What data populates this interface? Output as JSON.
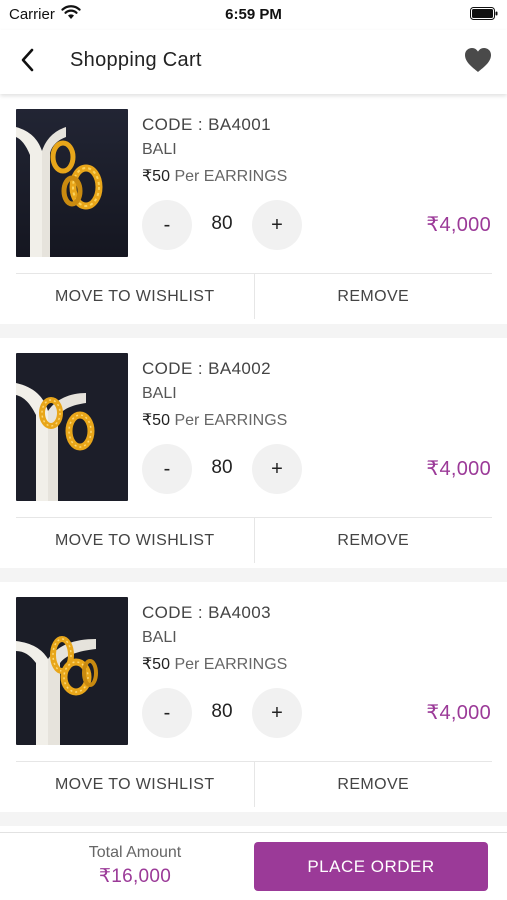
{
  "status_bar": {
    "carrier": "Carrier",
    "time": "6:59 PM"
  },
  "nav": {
    "title": "Shopping Cart",
    "back_icon": "chevron-left-icon",
    "wishlist_icon": "heart-icon"
  },
  "cart": {
    "items": [
      {
        "code": "CODE : BA4001",
        "category": "BALI",
        "price": "₹50",
        "per_unit": "Per EARRINGS",
        "quantity": "80",
        "line_total": "₹4,000",
        "minus_label": "-",
        "plus_label": "+",
        "move_label": "MOVE TO WISHLIST",
        "remove_label": "REMOVE"
      },
      {
        "code": "CODE : BA4002",
        "category": "BALI",
        "price": "₹50",
        "per_unit": "Per EARRINGS",
        "quantity": "80",
        "line_total": "₹4,000",
        "minus_label": "-",
        "plus_label": "+",
        "move_label": "MOVE TO WISHLIST",
        "remove_label": "REMOVE"
      },
      {
        "code": "CODE : BA4003",
        "category": "BALI",
        "price": "₹50",
        "per_unit": "Per EARRINGS",
        "quantity": "80",
        "line_total": "₹4,000",
        "minus_label": "-",
        "plus_label": "+",
        "move_label": "MOVE TO WISHLIST",
        "remove_label": "REMOVE"
      }
    ]
  },
  "footer": {
    "total_label": "Total Amount",
    "total_value": "₹16,000",
    "place_order_label": "PLACE ORDER"
  },
  "colors": {
    "accent": "#9b3a98",
    "product_background": "#1a1c28",
    "gold": "#e8a61a"
  }
}
